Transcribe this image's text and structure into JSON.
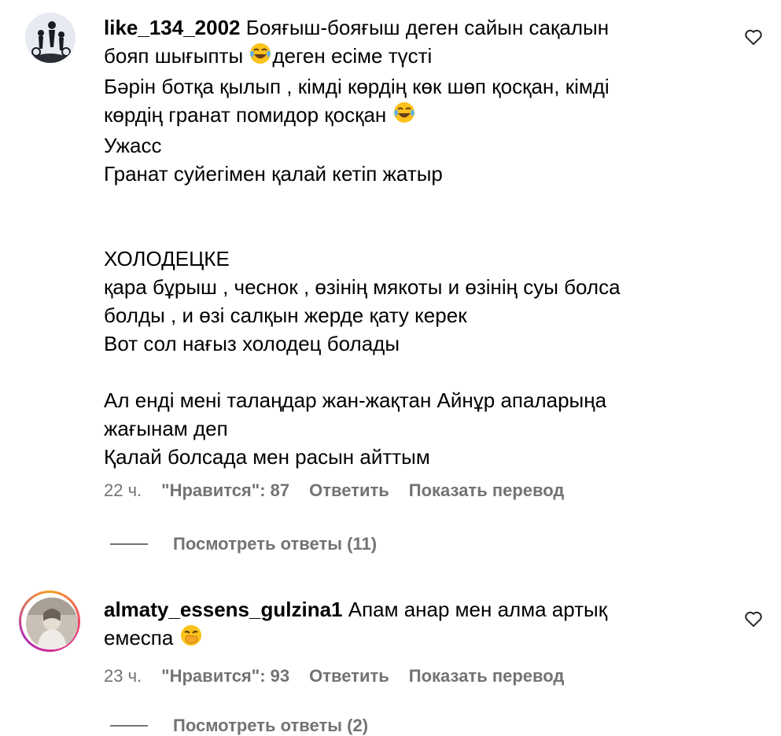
{
  "comments": [
    {
      "username": "like_134_2002",
      "lines": [
        "Бояғыш-бояғыш деген сайын сақалын",
        "бояп шығыпты ",
        "деген есіме түсті",
        "Бәрін ботқа қылып , кімді көрдің көк шөп қосқан, кімді",
        "көрдің гранат помидор қосқан ",
        "Ужасс",
        "Гранат суйегімен қалай кетіп жатыр",
        "ХОЛОДЕЦКЕ",
        "қара бұрыш , чеснок , өзінің мякоты и өзінің суы болса",
        "болды , и өзі салқын жерде қату керек",
        "Вот сол нағыз холодец болады",
        "Ал енді мені талаңдар жан-жақтан Айнұр апаларыңа",
        "жағынам деп",
        "Қалай болсада мен расын айттым"
      ],
      "time": "22 ч.",
      "likes": "\"Нравится\": 87",
      "reply": "Ответить",
      "translate": "Показать перевод",
      "view_replies": "Посмотреть ответы (11)",
      "emoji": "face-with-tears-of-joy"
    },
    {
      "username": "almaty_essens_gulzina1",
      "lines": [
        "Апам анар мен алма артық",
        "емеспа "
      ],
      "time": "23 ч.",
      "likes": "\"Нравится\": 93",
      "reply": "Ответить",
      "translate": "Показать перевод",
      "view_replies": "Посмотреть ответы (2)",
      "emoji": "face-with-hand-over-mouth"
    }
  ],
  "icons": {
    "heart": "heart-outline-icon"
  },
  "colors": {
    "secondary_text": "#737373",
    "story_ring": "#ee2a7b"
  }
}
